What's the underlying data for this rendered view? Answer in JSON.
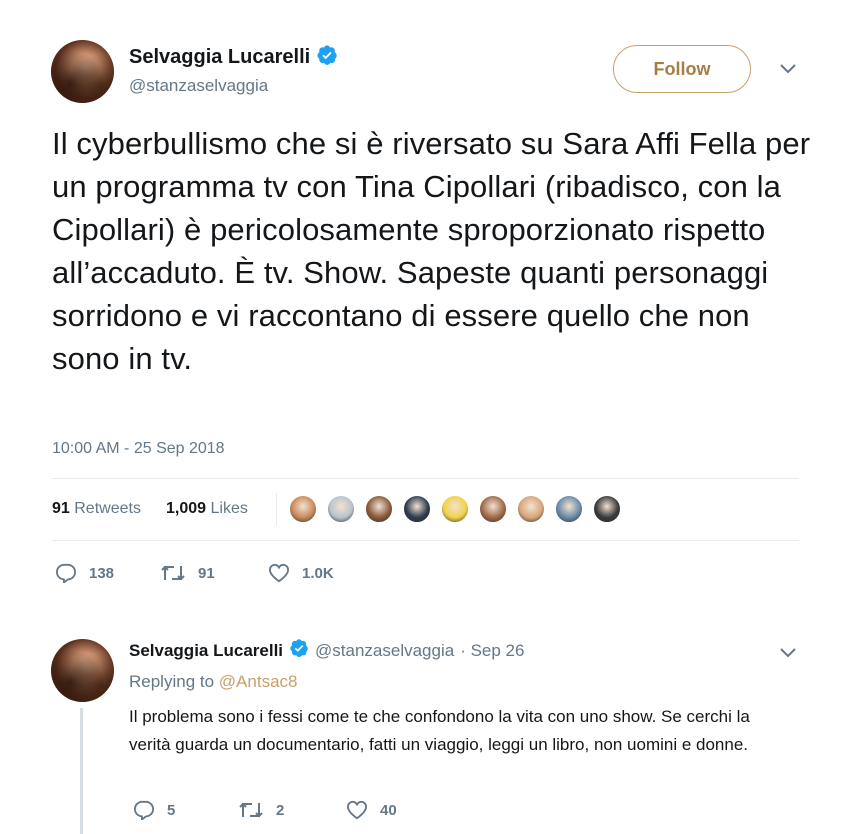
{
  "tweet": {
    "author_name": "Selvaggia Lucarelli",
    "author_handle": "@stanzaselvaggia",
    "follow_label": "Follow",
    "text": "Il cyberbullismo che si è riversato su Sara Affi Fella per un programma tv con Tina Cipollari (ribadisco, con la Cipollari) è pericolosamente sproporzionato rispetto all’accaduto. È tv. Show. Sapeste quanti personaggi sorridono e vi raccontano di essere quello che non sono in tv.",
    "timestamp": "10:00 AM - 25 Sep 2018",
    "stats": {
      "retweets_count": "91",
      "retweets_label": "Retweets",
      "likes_count": "1,009",
      "likes_label": "Likes"
    },
    "actions": {
      "replies": "138",
      "retweets": "91",
      "likes": "1.0K"
    },
    "likers": [
      {
        "color": "#c98a5a"
      },
      {
        "color": "#b8c4cc"
      },
      {
        "color": "#8a5a3c"
      },
      {
        "color": "#2e3b4e"
      },
      {
        "color": "#f2d24a"
      },
      {
        "color": "#a06a48"
      },
      {
        "color": "#d9a67a"
      },
      {
        "color": "#6a8aa8"
      },
      {
        "color": "#3a3a3a"
      }
    ]
  },
  "reply": {
    "author_name": "Selvaggia Lucarelli",
    "author_handle": "@stanzaselvaggia",
    "date": "· Sep 26",
    "replying_prefix": "Replying to",
    "replying_to": "@Antsac8",
    "text": "Il problema sono i fessi come te che confondono la vita con uno show. Se cerchi la verità guarda un documentario, fatti un viaggio, leggi un libro, non uomini e donne.",
    "actions": {
      "replies": "5",
      "retweets": "2",
      "likes": "40"
    }
  },
  "colors": {
    "accent": "#c8a06b",
    "secondary_text": "#657786",
    "verified": "#1da1f2"
  }
}
